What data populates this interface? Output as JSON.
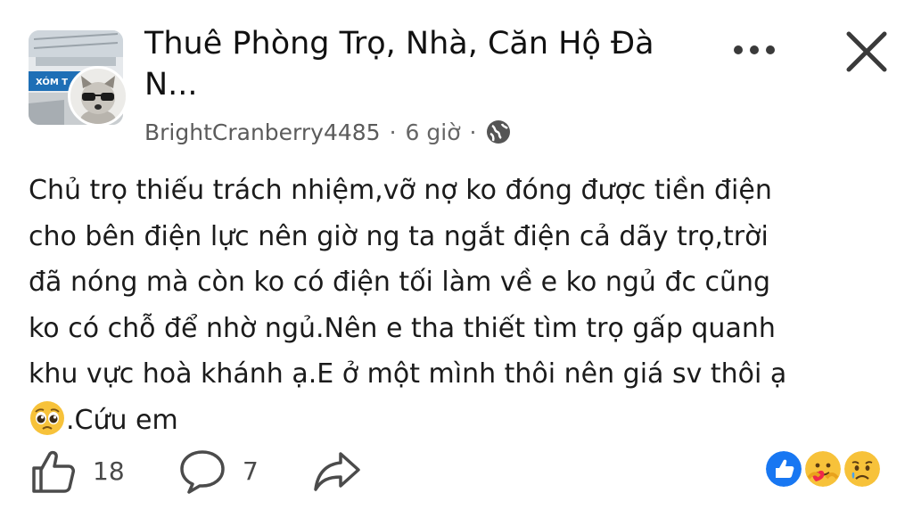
{
  "group": {
    "name": "Thuê Phòng Trọ, Nhà, Căn Hộ Đà N...",
    "avatar_banner_text": "XÓM T"
  },
  "post": {
    "author": "BrightCranberry4485",
    "time": "6 giờ",
    "separator": "·",
    "privacy_icon": "globe-icon",
    "text_before_emoji": "Chủ trọ thiếu trách nhiệm,vỡ nợ ko đóng được tiền điện\ncho bên điện lực nên giờ ng ta ngắt điện cả dãy trọ,trời\nđã nóng mà còn ko có điện tối làm về e ko ngủ đc cũng\nko có chỗ để nhờ ngủ.Nên e tha thiết tìm trọ gấp quanh\nkhu vực hoà khánh ạ.E ở một mình thôi nên giá sv thôi ạ\n",
    "emoji": "pleading-face",
    "text_after_emoji": ".Cứu em"
  },
  "actions": {
    "like_count": "18",
    "comment_count": "7"
  },
  "reactions": [
    "like",
    "care",
    "sad"
  ],
  "colors": {
    "like_blue": "#1877f2",
    "emoji_yellow": "#f7c23a",
    "icon_gray": "#4b4b4b"
  }
}
